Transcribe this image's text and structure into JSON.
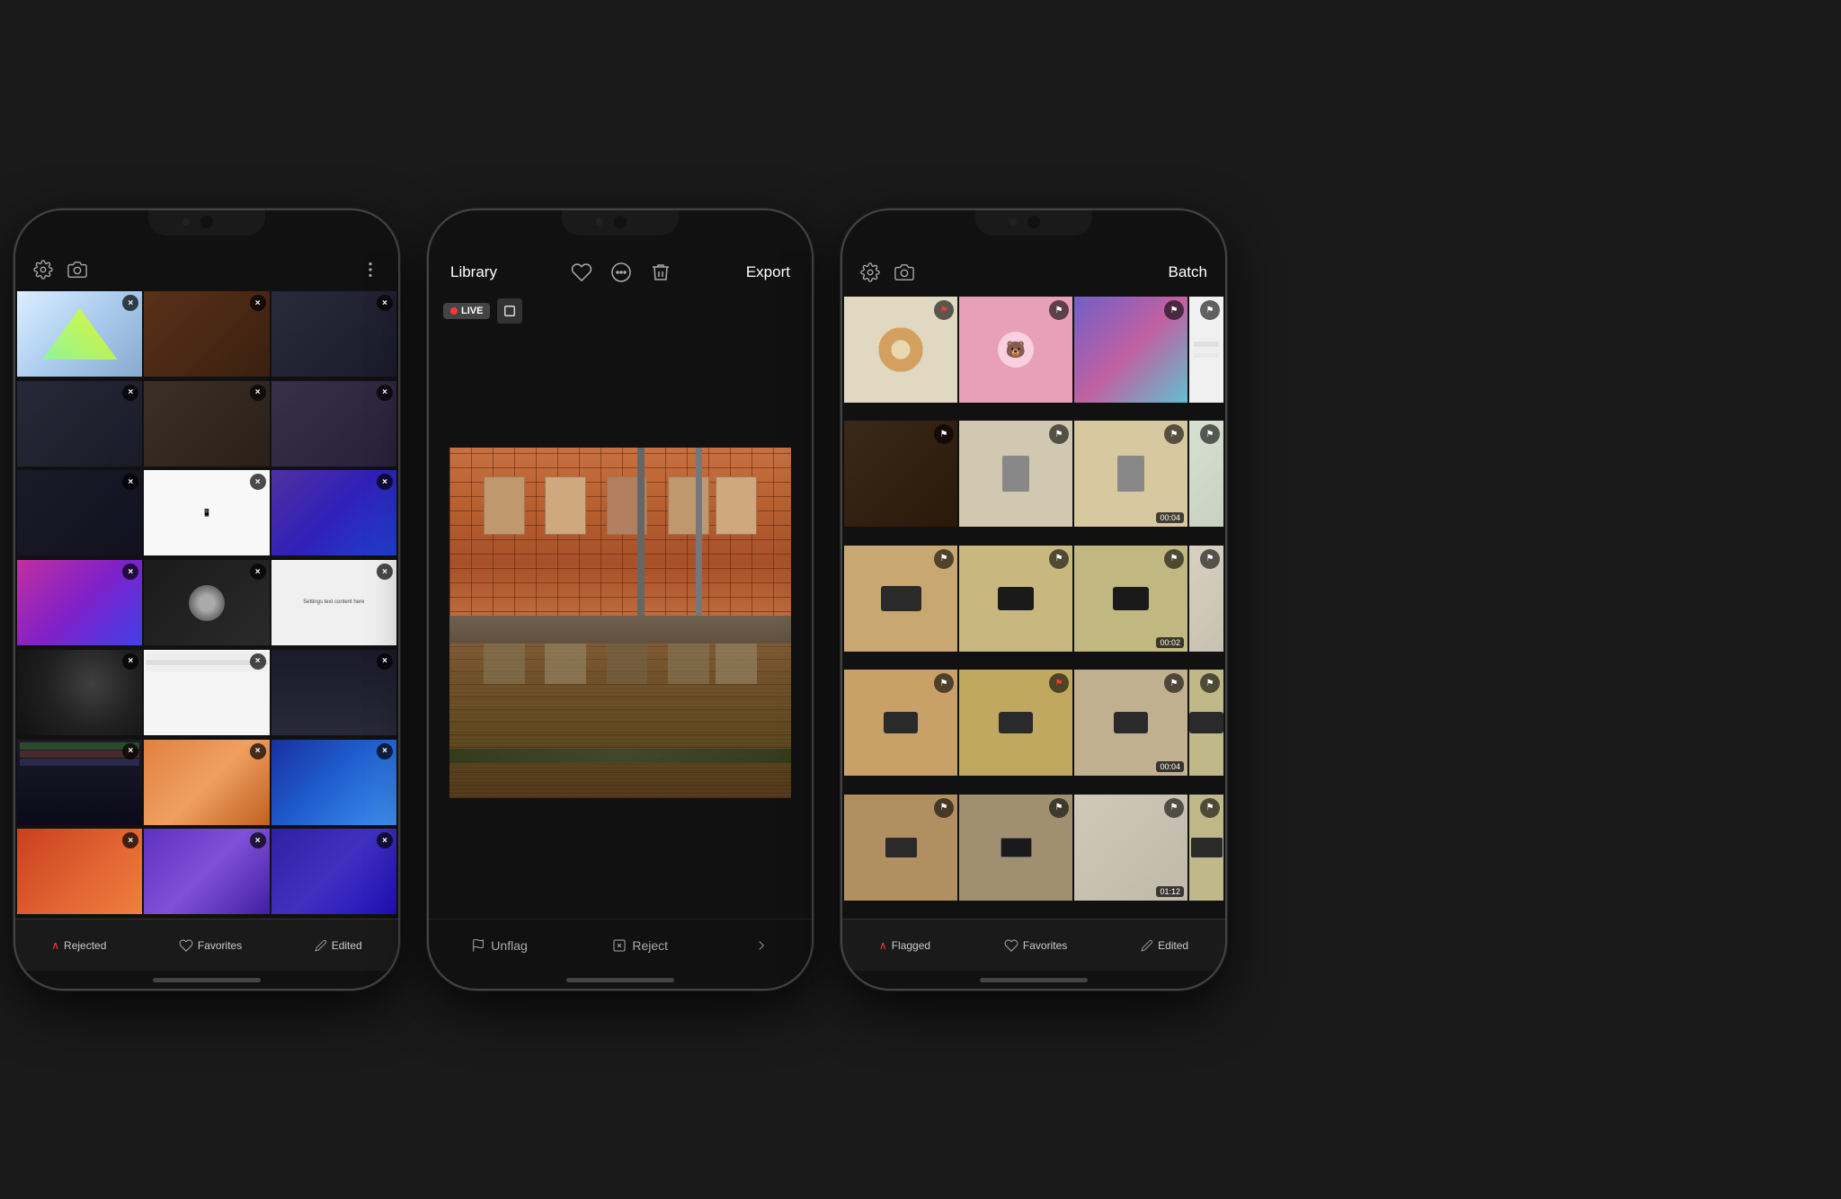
{
  "phones": {
    "left": {
      "toolbar": {
        "left_icon": "gear",
        "right_icon": "more",
        "camera_icon": "camera"
      },
      "bottom_bar": {
        "items": [
          {
            "label": "Rejected",
            "icon": "chevron-up",
            "color": "#ff3b30"
          },
          {
            "label": "Favorites",
            "icon": "heart"
          },
          {
            "label": "Edited",
            "icon": "pencil"
          }
        ]
      },
      "photos": [
        {
          "bg": "#e8f4ff",
          "has_close": true,
          "col": 0
        },
        {
          "bg": "#3a2a1a",
          "has_close": true,
          "col": 1
        },
        {
          "bg": "#2a2a3a",
          "has_close": true,
          "col": 2
        },
        {
          "bg": "#1a1a2a",
          "has_close": true,
          "col": 3
        },
        {
          "bg": "#3a3020",
          "has_close": true,
          "col": 4
        },
        {
          "bg": "#2a3040",
          "has_close": true,
          "col": 5
        },
        {
          "bg": "#1a2030",
          "has_close": true,
          "col": 6
        },
        {
          "bg": "#2a1a2a",
          "has_close": true,
          "col": 7
        },
        {
          "bg": "#2a2a1a",
          "has_close": true,
          "col": 8
        },
        {
          "bg": "#1a3a2a",
          "has_close": true,
          "col": 9
        },
        {
          "bg": "#3a2030",
          "has_close": true,
          "col": 10
        },
        {
          "bg": "#2030a0",
          "has_close": true,
          "col": 11
        },
        {
          "bg": "#1a1a1a",
          "has_close": true,
          "col": 12
        },
        {
          "bg": "#2a2030",
          "has_close": true,
          "col": 13
        },
        {
          "bg": "#3a3a3a",
          "has_close": true,
          "col": 14
        },
        {
          "bg": "#202040",
          "has_close": true,
          "col": 15
        },
        {
          "bg": "#301020",
          "has_close": true,
          "col": 16
        },
        {
          "bg": "#203040",
          "has_close": true,
          "col": 17
        },
        {
          "bg": "#3a1a2a",
          "has_close": true,
          "col": 18
        },
        {
          "bg": "#1a301a",
          "has_close": true,
          "col": 19
        },
        {
          "bg": "#404040",
          "has_close": true,
          "col": 20
        }
      ]
    },
    "center": {
      "toolbar": {
        "library_label": "Library",
        "export_label": "Export"
      },
      "live_bar": {
        "live_label": "LIVE",
        "still_icon": "rectangle"
      },
      "main_photo": {
        "alt": "Brick building reflection in water"
      },
      "bottom_actions": [
        {
          "label": "Unflag",
          "icon": "flag"
        },
        {
          "label": "Reject",
          "icon": "x-square"
        },
        {
          "icon": "chevron-right"
        }
      ]
    },
    "right": {
      "toolbar": {
        "gear_icon": "gear",
        "camera_icon": "camera",
        "batch_label": "Batch"
      },
      "bottom_bar": {
        "items": [
          {
            "label": "Flagged",
            "icon": "chevron-up",
            "color": "#ff3b30"
          },
          {
            "label": "Favorites",
            "icon": "heart"
          },
          {
            "label": "Edited",
            "icon": "pencil"
          }
        ]
      },
      "photos": [
        {
          "bg": "#e0d8c0",
          "flag": "red",
          "type": "donut"
        },
        {
          "bg": "#e8a0b0",
          "flag": "white",
          "type": "cartoon"
        },
        {
          "bg": "#7060c8",
          "flag": "white",
          "type": "gradient"
        },
        {
          "bg": "#c0c0c0",
          "flag": "white",
          "type": "note"
        },
        {
          "bg": "#3a2818",
          "flag": "white",
          "type": "screen"
        },
        {
          "bg": "#c8b890",
          "flag": "white",
          "type": "screen"
        },
        {
          "bg": "#c8b870",
          "flag": "white",
          "type": "screen",
          "duration": "00:04"
        },
        {
          "bg": "#e8e0d0",
          "flag": "white",
          "type": "brick"
        },
        {
          "bg": "#c8a870",
          "flag": "white",
          "type": "device"
        },
        {
          "bg": "#c8b880",
          "flag": "white",
          "type": "device"
        },
        {
          "bg": "#c8b080",
          "flag": "white",
          "type": "device",
          "duration": "00:02"
        },
        {
          "bg": "#c0b8a0",
          "flag": "white",
          "type": "device"
        },
        {
          "bg": "#c8a860",
          "flag": "white",
          "type": "device"
        },
        {
          "bg": "#c8b068",
          "flag": "red",
          "type": "device"
        },
        {
          "bg": "#c0b090",
          "flag": "white",
          "type": "device",
          "duration": "00:04"
        },
        {
          "bg": "#c8b880",
          "flag": "white",
          "type": "device"
        },
        {
          "bg": "#b09060",
          "flag": "white",
          "type": "device"
        },
        {
          "bg": "#a09080",
          "flag": "white",
          "type": "device"
        },
        {
          "bg": "#c0b8a8",
          "flag": "white",
          "type": "brick",
          "duration": "01:12"
        },
        {
          "bg": "#d0c8b8",
          "flag": "white",
          "type": "device"
        }
      ]
    }
  }
}
